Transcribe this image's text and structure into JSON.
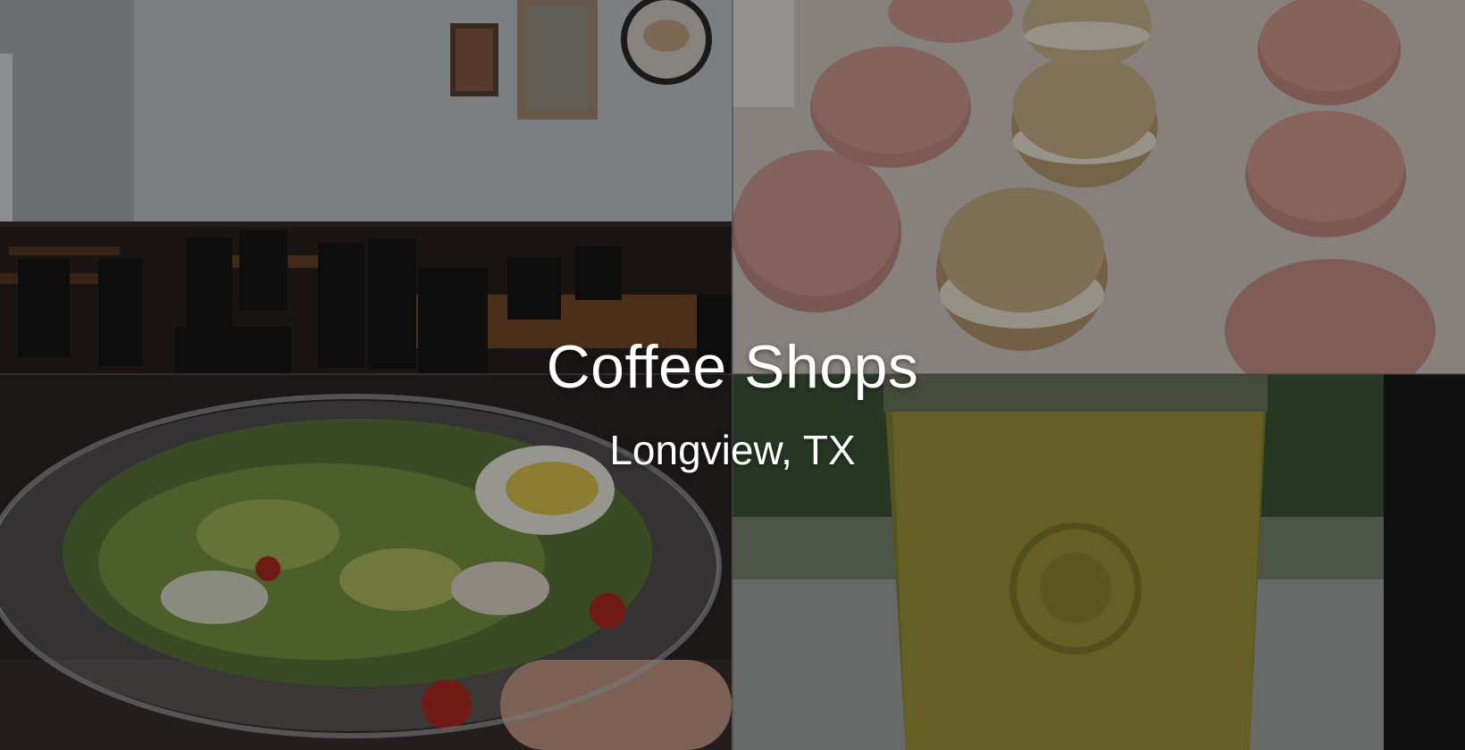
{
  "hero": {
    "title": "Coffee Shops",
    "subtitle": "Longview, TX",
    "overlay_color": "#000000",
    "tiles": [
      {
        "name": "restaurant-interior-photo"
      },
      {
        "name": "macarons-photo"
      },
      {
        "name": "salad-bowl-photo"
      },
      {
        "name": "iced-drink-cup-photo"
      }
    ]
  }
}
